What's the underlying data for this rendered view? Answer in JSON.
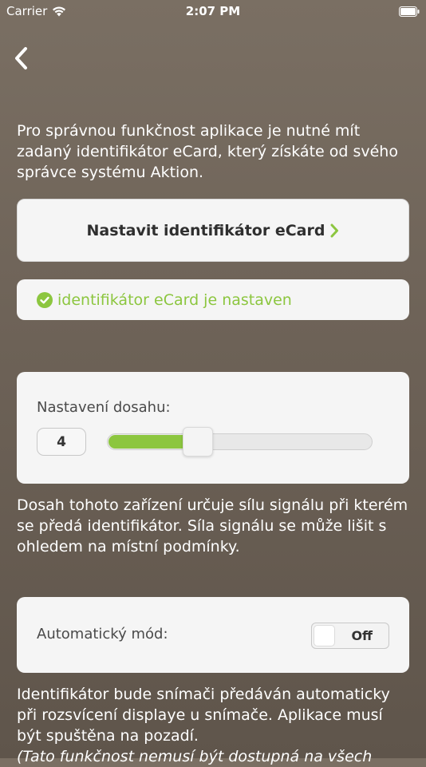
{
  "status_bar": {
    "carrier": "Carrier",
    "time": "2:07 PM"
  },
  "intro": {
    "text": "Pro správnou funkčnost aplikace je nutné mít zadaný identifikátor eCard, který získáte od svého správce systému Aktion."
  },
  "set_ecard": {
    "label": "Nastavit identifikátor eCard"
  },
  "ecard_status": {
    "text": "identifikátor eCard je nastaven"
  },
  "range": {
    "label": "Nastavení dosahu:",
    "value": "4",
    "slider_fraction": 0.34,
    "description": "Dosah tohoto zařízení určuje sílu signálu při kterém se předá identifikátor. Síla signálu se může lišit s ohledem na místní podmínky."
  },
  "auto_mode": {
    "label": "Automatický mód:",
    "toggle_label": "Off",
    "description": "Identifikátor bude snímači předáván automaticky při rozsvícení displaye u snímače. Aplikace musí být spuštěna na pozadí.",
    "note": "(Tato funkčnost nemusí být dostupná na všech"
  },
  "colors": {
    "accent_green": "#8cc63f",
    "background": "#6d6257",
    "card": "#f5f5f5"
  },
  "icons": {
    "back": "chevron-left-icon",
    "wifi": "wifi-icon",
    "battery": "battery-icon",
    "check": "check-circle-icon",
    "arrow": "chevron-right-icon"
  }
}
